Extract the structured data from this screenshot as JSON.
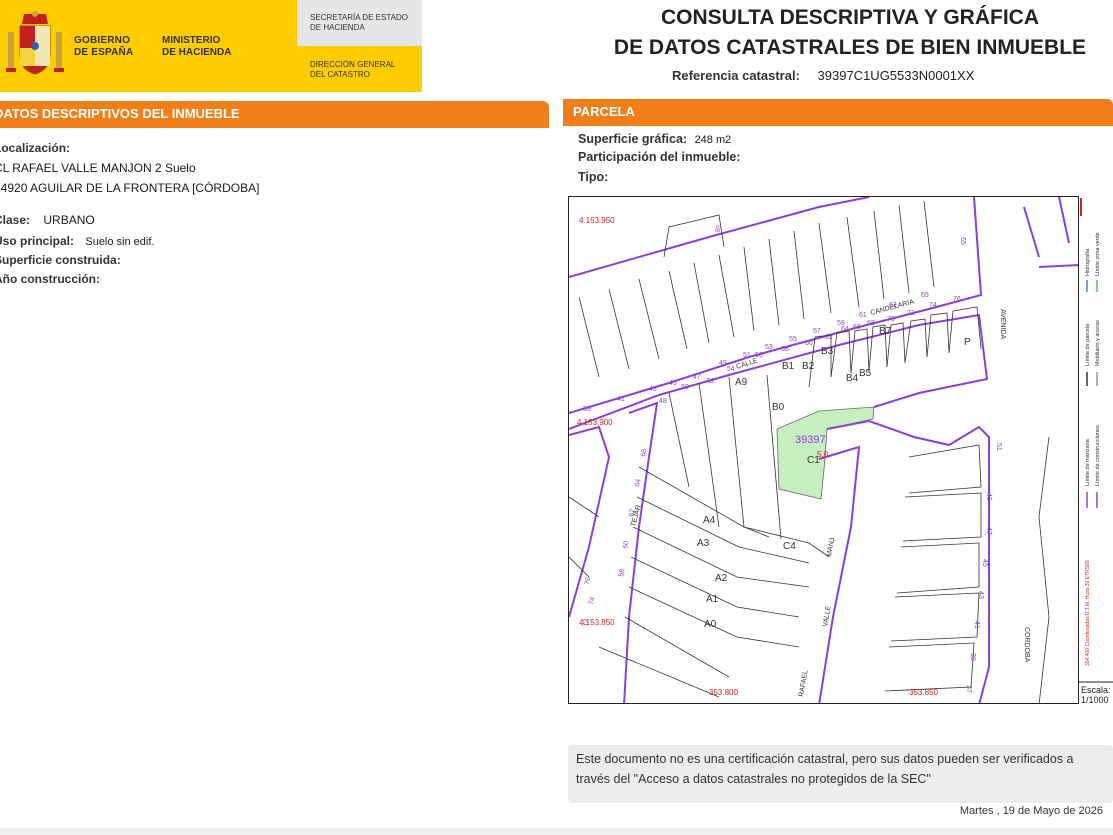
{
  "header": {
    "gobierno": [
      "GOBIERNO",
      "DE ESPAÑA"
    ],
    "ministerio": [
      "MINISTERIO",
      "DE HACIENDA"
    ],
    "secretaria": [
      "SECRETARÍA DE ESTADO",
      "DE HACIENDA"
    ],
    "direccion": [
      "DIRECCIÓN GENERAL",
      "DEL CATASTRO"
    ],
    "title_line1": "CONSULTA DESCRIPTIVA Y GRÁFICA",
    "title_line2": "DE DATOS CATASTRALES DE BIEN INMUEBLE",
    "ref_label": "Referencia catastral:",
    "ref_value": "39397C1UG5533N0001XX"
  },
  "left": {
    "section_title": "DATOS DESCRIPTIVOS DEL INMUEBLE",
    "localizacion_label": "Localización:",
    "address_line1": "CL RAFAEL VALLE MANJON 2 Suelo",
    "address_line2": "14920 AGUILAR DE LA FRONTERA [CÓRDOBA]",
    "clase_label": "Clase:",
    "clase_value": "URBANO",
    "uso_label": "Uso principal:",
    "uso_value": "Suelo sin edif.",
    "superficie_label": "Superficie construida:",
    "anio_label": "Año construcción:"
  },
  "right": {
    "section_title": "PARCELA",
    "superficie_label": "Superficie gráfica:",
    "superficie_value": "248 m2",
    "participacion_label": "Participación del inmueble:",
    "tipo_label": "Tipo:"
  },
  "map": {
    "coords": [
      "4.153.950",
      "4.153.900",
      "4.153.850",
      "353.800",
      "353.850"
    ],
    "parcel_id": "39397",
    "parcel_sub": "C1",
    "parcel_red": "5.0",
    "block_labels": [
      "A0",
      "A1",
      "A2",
      "A3",
      "A4",
      "A9",
      "B0",
      "B1",
      "B2",
      "B3",
      "B4",
      "B5",
      "B7",
      "C4",
      "P"
    ],
    "street_names": [
      "CALLE",
      "CANDELARIA",
      "RAFAEL",
      "VALLE",
      "MANJ",
      "TEJAR",
      "AVENIDA",
      "CORDOBA"
    ],
    "numbers_top": [
      "39",
      "41",
      "43",
      "45",
      "47",
      "49",
      "51",
      "53",
      "55",
      "57",
      "59",
      "61",
      "63",
      "65"
    ],
    "numbers_mid": [
      "46",
      "48",
      "50",
      "52",
      "54",
      "56",
      "58",
      "60",
      "62",
      "64",
      "66",
      "68",
      "70",
      "72",
      "74",
      "76"
    ],
    "numbers_right": [
      "51",
      "49",
      "47",
      "45",
      "43",
      "41",
      "39",
      "37"
    ],
    "numbers_top_right": [
      "65",
      "85"
    ],
    "numbers_left": [
      "66",
      "64",
      "62",
      "60",
      "58",
      "76",
      "74",
      "72"
    ]
  },
  "legend": {
    "items": [
      "Límite de manzana",
      "Límite de parcela",
      "Límite de construcciones",
      "Mobiliario y aceras",
      "Límite zona verde",
      "Hidrografía"
    ],
    "coord_system": "354.400 Coordenadas U.T.M. Huso 30 ETRS89",
    "scale_label": "Escala:",
    "scale_value": "1/1000"
  },
  "notice": "Este documento no es una certificación catastral, pero sus datos pueden ser verificados a través del \"Acceso a datos catastrales no protegidos de la SEC\"",
  "date": "Martes , 19 de Mayo de 2026",
  "colors": {
    "orange": "#f07f1a",
    "yellow": "#ffcc00",
    "purple": "#8b3fd6",
    "parcel_green": "#c6efc0"
  }
}
